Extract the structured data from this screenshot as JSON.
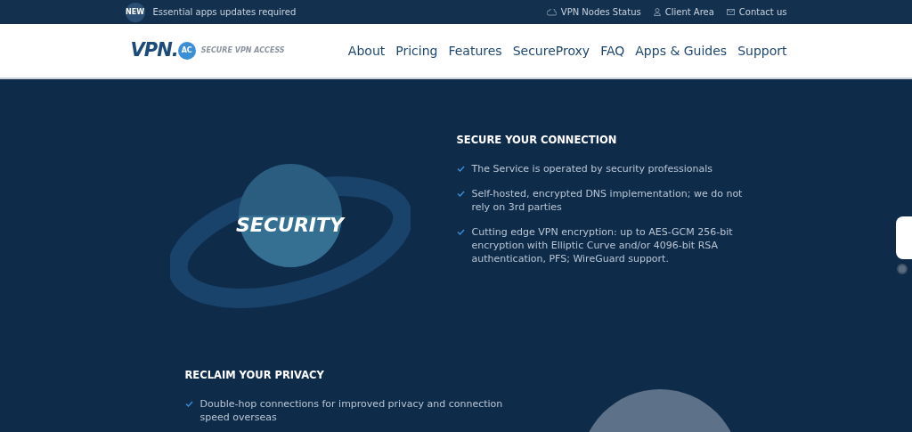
{
  "top_bar": {
    "badge": "NEW",
    "notice": "Essential apps updates required",
    "links": [
      {
        "kind": "status",
        "label": "VPN Nodes Status"
      },
      {
        "kind": "user",
        "label": "Client Area"
      },
      {
        "kind": "mail",
        "label": "Contact us"
      }
    ]
  },
  "nav": {
    "logo": {
      "text": "VPN.",
      "badge": "AC",
      "tagline": "SECURE VPN ACCESS"
    },
    "items": [
      "About",
      "Pricing",
      "Features",
      "SecureProxy",
      "FAQ",
      "Apps & Guides",
      "Support"
    ]
  },
  "sections": [
    {
      "image_title": "SECURITY",
      "heading": "SECURE YOUR CONNECTION",
      "points": [
        "The Service is operated by security professionals",
        "Self-hosted, encrypted DNS implementation; we do not rely on 3rd parties",
        "Cutting edge VPN encryption: up to AES-GCM 256-bit encryption with Elliptic Curve and/or 4096-bit RSA authentication, PFS; WireGuard support."
      ]
    },
    {
      "heading": "RECLAIM YOUR PRIVACY",
      "points": [
        "Double-hop connections for improved privacy and connection speed overseas"
      ]
    }
  ]
}
